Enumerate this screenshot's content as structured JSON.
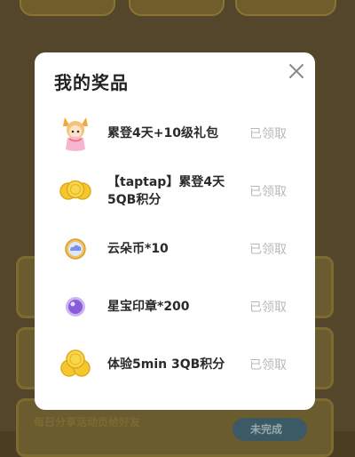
{
  "modal": {
    "title": "我的奖品",
    "prizes": [
      {
        "name": "累登4天+10级礼包",
        "status": "已领取",
        "icon": "fox-girl-avatar-icon"
      },
      {
        "name": "【taptap】累登4天5QB积分",
        "status": "已领取",
        "icon": "gold-coins-icon"
      },
      {
        "name": "云朵币*10",
        "status": "已领取",
        "icon": "cloud-coin-icon"
      },
      {
        "name": "星宝印章*200",
        "status": "已领取",
        "icon": "star-seal-icon"
      },
      {
        "name": "体验5min 3QB积分",
        "status": "已领取",
        "icon": "gold-coins-icon"
      }
    ]
  },
  "background": {
    "footer_text": "每日分享活动页给好友",
    "footer_button": "未完成"
  }
}
